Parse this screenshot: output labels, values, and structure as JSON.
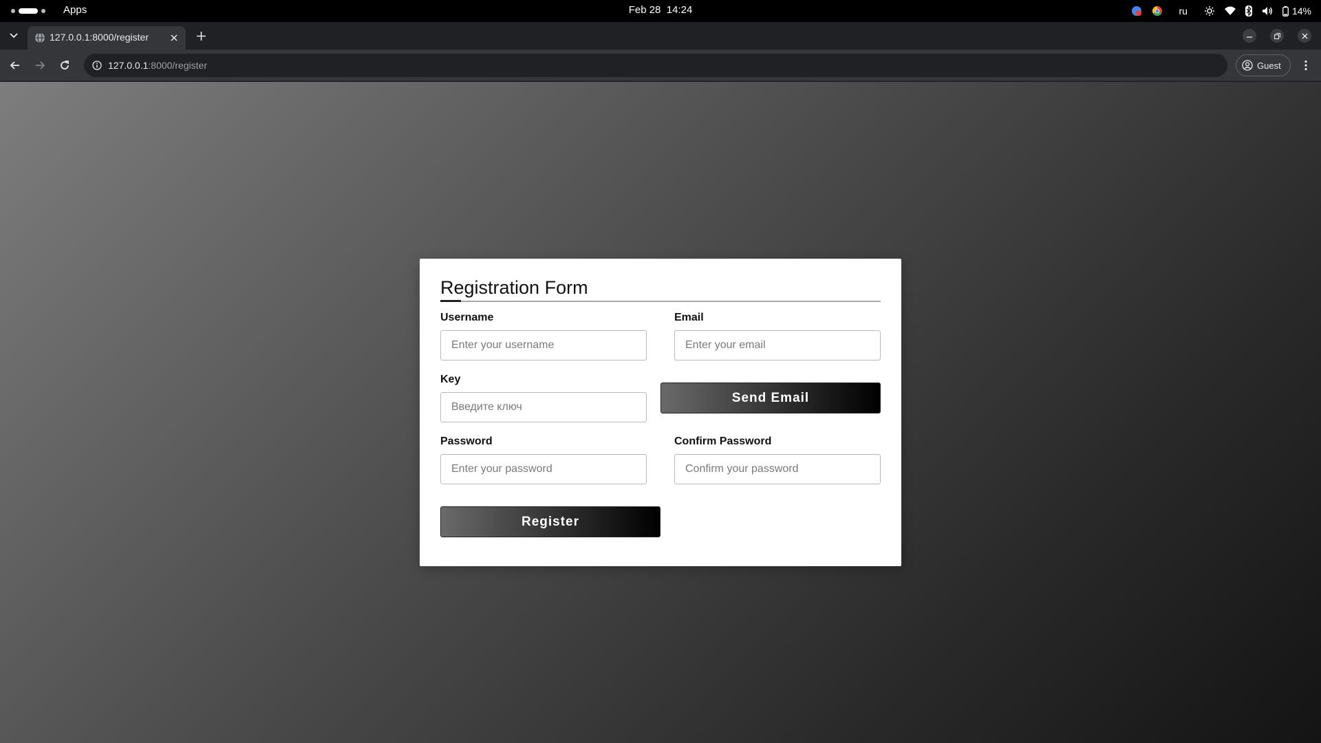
{
  "os_bar": {
    "apps_label": "Apps",
    "date": "Feb 28",
    "time": "14:24",
    "keyboard_layout": "ru",
    "battery": "14%"
  },
  "browser": {
    "tab_title": "127.0.0.1:8000/register",
    "url_host": "127.0.0.1",
    "url_path": ":8000/register",
    "profile_label": "Guest"
  },
  "form": {
    "title": "Registration Form",
    "username": {
      "label": "Username",
      "placeholder": "Enter your username",
      "value": ""
    },
    "email": {
      "label": "Email",
      "placeholder": "Enter your email",
      "value": ""
    },
    "key": {
      "label": "Key",
      "placeholder": "Введите ключ",
      "value": ""
    },
    "send_email_label": "Send Email",
    "password": {
      "label": "Password",
      "placeholder": "Enter your password",
      "value": ""
    },
    "confirm_password": {
      "label": "Confirm Password",
      "placeholder": "Confirm your password",
      "value": ""
    },
    "register_label": "Register"
  },
  "colors": {
    "button_gradient_start": "#6a6a6a",
    "button_gradient_end": "#000000",
    "card_background": "#ffffff",
    "page_gradient_start": "#7d7d7d",
    "page_gradient_end": "#141414"
  }
}
